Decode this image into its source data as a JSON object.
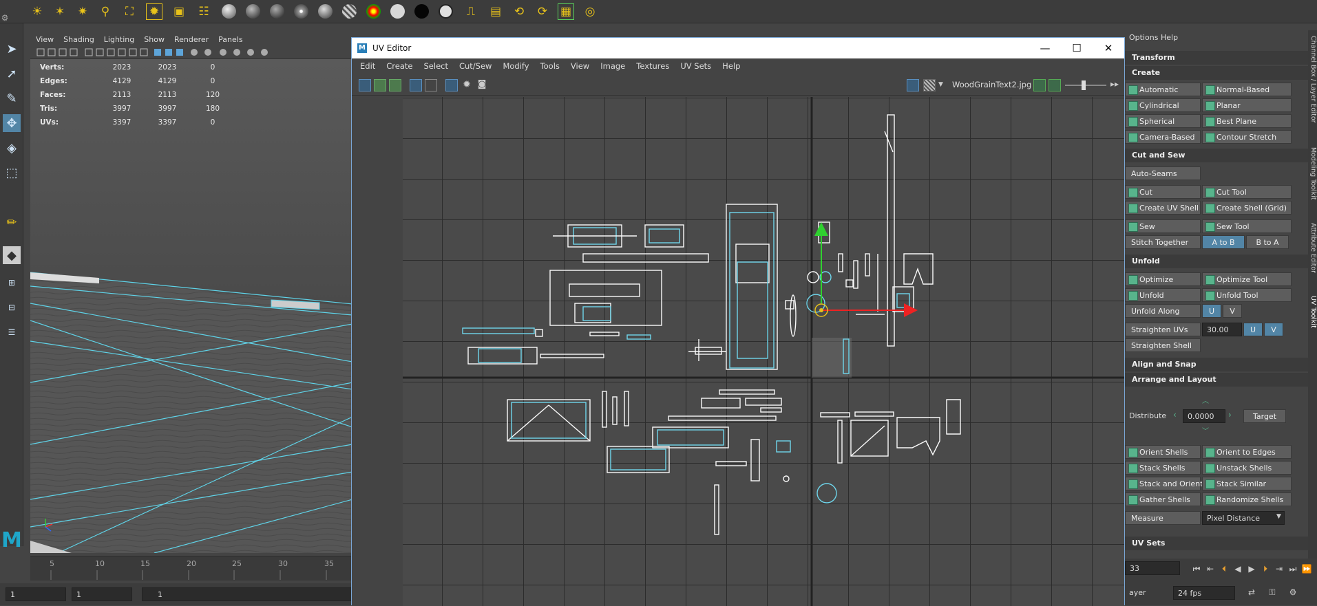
{
  "shelf": {
    "icons": [
      "sun-light-icon",
      "ambient-light-icon",
      "point-light-icon",
      "spot-light-icon",
      "area-light-icon",
      "volume-light-icon",
      "camera-icon",
      "render-settings-icon",
      "material-ball-icon",
      "shading-sphere-icon",
      "grey-ball-icon",
      "white-dot-ball-icon",
      "specular-ball-icon",
      "striped-ball-icon",
      "ramp-ball-icon",
      "white-ball-icon",
      "black-ball-icon",
      "outline-ball-icon",
      "hypershade-icon",
      "render-view-icon",
      "ipr-icon",
      "batch-render-icon",
      "render-sequence-icon",
      "render-target-icon"
    ]
  },
  "viewport": {
    "menu": [
      "View",
      "Shading",
      "Lighting",
      "Show",
      "Renderer",
      "Panels"
    ],
    "hud": {
      "rows": [
        {
          "label": "Verts:",
          "a": "2023",
          "b": "2023",
          "c": "0"
        },
        {
          "label": "Edges:",
          "a": "4129",
          "b": "4129",
          "c": "0"
        },
        {
          "label": "Faces:",
          "a": "2113",
          "b": "2113",
          "c": "120"
        },
        {
          "label": "Tris:",
          "a": "3997",
          "b": "3997",
          "c": "180"
        },
        {
          "label": "UVs:",
          "a": "3397",
          "b": "3397",
          "c": "0"
        }
      ]
    }
  },
  "timeline": {
    "ticks": [
      "5",
      "10",
      "15",
      "20",
      "25",
      "30",
      "35"
    ],
    "range_start": "1",
    "range_current": "1",
    "range_field3": "1"
  },
  "uv_editor": {
    "title": "UV Editor",
    "logo": "M",
    "menu": [
      "Edit",
      "Create",
      "Select",
      "Cut/Sew",
      "Modify",
      "Tools",
      "View",
      "Image",
      "Textures",
      "UV Sets",
      "Help"
    ],
    "texture_name": "WoodGrainText2.jpg"
  },
  "toolkit": {
    "menu": [
      "Options",
      "Help"
    ],
    "sections": {
      "transform": "Transform",
      "create": "Create",
      "cut_sew": "Cut and Sew",
      "unfold": "Unfold",
      "align": "Align and Snap",
      "arrange": "Arrange and Layout",
      "uvsets": "UV Sets"
    },
    "create": {
      "automatic": "Automatic",
      "normal_based": "Normal-Based",
      "cylindrical": "Cylindrical",
      "planar": "Planar",
      "spherical": "Spherical",
      "best_plane": "Best Plane",
      "camera_based": "Camera-Based",
      "contour_stretch": "Contour Stretch"
    },
    "cut": {
      "auto_seams": "Auto-Seams",
      "cut": "Cut",
      "cut_tool": "Cut Tool",
      "create_shell": "Create UV Shell",
      "create_shell_grid": "Create Shell (Grid)",
      "sew": "Sew",
      "sew_tool": "Sew Tool",
      "stitch": "Stitch Together",
      "a_to_b": "A to B",
      "b_to_a": "B to A"
    },
    "unfold": {
      "optimize": "Optimize",
      "optimize_tool": "Optimize Tool",
      "unfold": "Unfold",
      "unfold_tool": "Unfold Tool",
      "unfold_along": "Unfold Along",
      "u": "U",
      "v": "V",
      "straighten_uvs": "Straighten UVs",
      "angle": "30.00",
      "straighten_shell": "Straighten Shell"
    },
    "arrange": {
      "distribute": "Distribute",
      "distribute_value": "0.0000",
      "target": "Target",
      "orient_shells": "Orient Shells",
      "orient_edges": "Orient to Edges",
      "stack_shells": "Stack Shells",
      "unstack_shells": "Unstack Shells",
      "stack_orient": "Stack and Orient",
      "stack_similar": "Stack Similar",
      "gather_shells": "Gather Shells",
      "randomize_shells": "Randomize Shells",
      "measure": "Measure",
      "measure_value": "Pixel Distance"
    }
  },
  "side_tabs": [
    "Channel Box / Layer Editor",
    "Modeling Toolkit",
    "Attribute Editor",
    "UV Toolkit"
  ],
  "playback": {
    "frame": "33",
    "layer": "ayer",
    "fps": "24 fps"
  }
}
